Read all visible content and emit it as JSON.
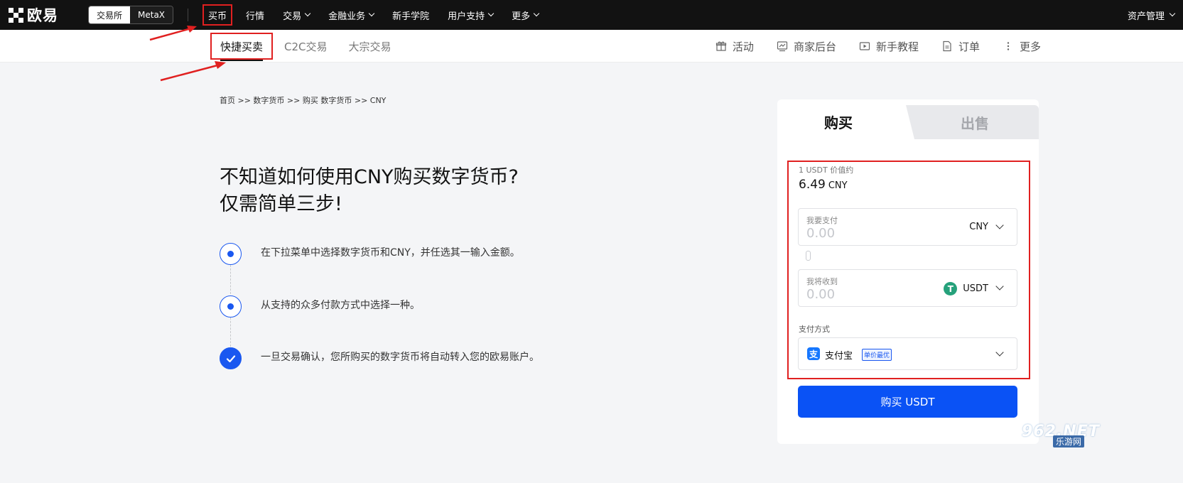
{
  "topbar": {
    "logo": "欧易",
    "switch": {
      "active": "交易所",
      "inactive": "MetaX"
    },
    "nav": [
      {
        "label": "买币",
        "dropdown": false,
        "highlighted": true
      },
      {
        "label": "行情",
        "dropdown": false
      },
      {
        "label": "交易",
        "dropdown": true
      },
      {
        "label": "金融业务",
        "dropdown": true
      },
      {
        "label": "新手学院",
        "dropdown": false
      },
      {
        "label": "用户支持",
        "dropdown": true
      },
      {
        "label": "更多",
        "dropdown": true
      }
    ],
    "assets": "资产管理"
  },
  "subnav": {
    "tabs": [
      "快捷买卖",
      "C2C交易",
      "大宗交易"
    ],
    "links": [
      {
        "label": "活动",
        "icon": "gift-icon"
      },
      {
        "label": "商家后台",
        "icon": "merchant-icon"
      },
      {
        "label": "新手教程",
        "icon": "play-icon"
      },
      {
        "label": "订单",
        "icon": "document-icon"
      },
      {
        "label": "更多",
        "icon": "more-vertical-icon"
      }
    ]
  },
  "main": {
    "breadcrumb": "首页 >> 数字货币 >> 购买 数字货币 >> CNY",
    "headline": [
      "不知道如何使用CNY购买数字货币?",
      "仅需简单三步!"
    ],
    "steps": [
      "在下拉菜单中选择数字货币和CNY，并任选其一输入金额。",
      "从支持的众多付款方式中选择一种。",
      "一旦交易确认，您所购买的数字货币将自动转入您的欧易账户。"
    ]
  },
  "panel": {
    "tab_buy": "购买",
    "tab_sell": "出售",
    "rate_label": "1 USDT 价值约",
    "rate_value": "6.49",
    "rate_currency": "CNY",
    "pay": {
      "label": "我要支付",
      "placeholder": "0.00",
      "currency": "CNY"
    },
    "receive": {
      "label": "我将收到",
      "placeholder": "0.00",
      "currency": "USDT",
      "icon_letter": "T"
    },
    "method_label": "支付方式",
    "method": {
      "name": "支付宝",
      "badge": "单价最优",
      "icon_letter": "支"
    },
    "buy_button": "购买 USDT"
  },
  "watermark": {
    "top": "962.NET",
    "bottom": "乐游网"
  },
  "colors": {
    "accent": "#0a52f5",
    "highlight": "#e02020",
    "tether": "#26a17b",
    "alipay": "#1677ff"
  }
}
